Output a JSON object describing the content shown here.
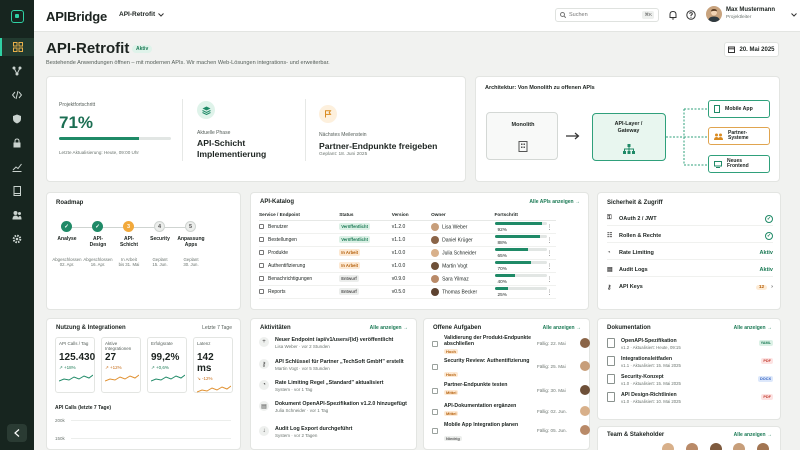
{
  "app": {
    "brand": "APIBridge",
    "project_selector": "API-Retrofit"
  },
  "search": {
    "placeholder": "Suchen",
    "shortcut": "⌘K"
  },
  "user": {
    "name": "Max Mustermann",
    "role": "Projektleiter"
  },
  "page": {
    "title": "API-Retrofit",
    "status_badge": "Aktiv",
    "subtitle": "Bestehende Anwendungen öffnen – mit modernen APIs. Wir machen Web-Lösungen integrations- und erweiterbar.",
    "date": "20. Mai 2025"
  },
  "overview": {
    "progress_label": "Projektfortschritt",
    "progress_value": "71%",
    "progress_fraction": 0.71,
    "last_update": "Letzte Aktualisierung: Heute, 09:00 Uhr",
    "phase_label": "Aktuelle Phase",
    "phase_value": "API-Schicht Implementierung",
    "milestone_label": "Nächstes Meilenstein",
    "milestone_value": "Partner-Endpunkte freigeben",
    "milestone_date": "Geplant: 18. Juni 2025"
  },
  "architecture": {
    "title": "Architektur: Von Monolith zu offenen APIs",
    "monolith": "Monolith",
    "layer_line1": "API-Layer /",
    "layer_line2": "Gateway",
    "targets": [
      "Mobile App",
      "Partner-\nSysteme",
      "Neues\nFrontend"
    ]
  },
  "roadmap": {
    "title": "Roadmap",
    "steps": [
      {
        "num": "✓",
        "label": "Analyse",
        "date": "Abgeschlossen\n02. Apr."
      },
      {
        "num": "✓",
        "label": "API-\nDesign",
        "date": "Abgeschlossen\n16. Apr."
      },
      {
        "num": "3",
        "label": "API-\nSchicht",
        "date": "In Arbeit\nbis 31. Mai"
      },
      {
        "num": "4",
        "label": "Security",
        "date": "Geplant\n15. Jun."
      },
      {
        "num": "5",
        "label": "Anpassung\nApps",
        "date": "Geplant\n30. Jun."
      }
    ]
  },
  "catalog": {
    "title": "API-Katalog",
    "link": "Alle APIs anzeigen →",
    "columns": [
      "Service / Endpoint",
      "Status",
      "Version",
      "Owner",
      "Fortschritt"
    ],
    "rows": [
      {
        "name": "Benutzer",
        "status": "Veröffentlicht",
        "kind": "green",
        "version": "v1.2.0",
        "owner": "Lisa Weber",
        "progress": "92%",
        "fraction": 0.92
      },
      {
        "name": "Bestellungen",
        "status": "Veröffentlicht",
        "kind": "green",
        "version": "v1.1.0",
        "owner": "Daniel Krüger",
        "progress": "88%",
        "fraction": 0.88
      },
      {
        "name": "Produkte",
        "status": "In Arbeit",
        "kind": "orange",
        "version": "v1.0.0",
        "owner": "Julia Schneider",
        "progress": "65%",
        "fraction": 0.65
      },
      {
        "name": "Authentifizierung",
        "status": "In Arbeit",
        "kind": "orange",
        "version": "v1.0.0",
        "owner": "Martin Vogt",
        "progress": "70%",
        "fraction": 0.7
      },
      {
        "name": "Benachrichtigungen",
        "status": "Entwurf",
        "kind": "gray",
        "version": "v0.9.0",
        "owner": "Sara Yilmaz",
        "progress": "40%",
        "fraction": 0.4
      },
      {
        "name": "Reports",
        "status": "Entwurf",
        "kind": "gray",
        "version": "v0.5.0",
        "owner": "Thomas Becker",
        "progress": "25%",
        "fraction": 0.25
      }
    ]
  },
  "security": {
    "title": "Sicherheit & Zugriff",
    "rows": [
      {
        "label": "OAuth 2 / JWT",
        "status": "✓"
      },
      {
        "label": "Rollen & Rechte",
        "status": "✓"
      },
      {
        "label": "Rate Limiting",
        "status": "Aktiv"
      },
      {
        "label": "Audit Logs",
        "status": "Aktiv"
      },
      {
        "label": "API Keys",
        "status": "12"
      }
    ]
  },
  "usage": {
    "title": "Nutzung & Integrationen",
    "range": "Letzte 7 Tage",
    "kpis": [
      {
        "label": "API Calls / Tag",
        "value": "125.430",
        "delta": "↗ +18%"
      },
      {
        "label": "Aktive Integrationen",
        "value": "27",
        "delta": "↗ +12%"
      },
      {
        "label": "Erfolgsrate",
        "value": "99,2%",
        "delta": "↗ +0,6%"
      },
      {
        "label": "Latenz",
        "value": "142 ms",
        "delta": "↘ -12%"
      }
    ],
    "chart_label": "API Calls (letzte 7 Tage)",
    "yticks": [
      "200k",
      "150k"
    ]
  },
  "activities": {
    "title": "Aktivitäten",
    "link": "Alle anzeigen →",
    "items": [
      {
        "title": "Neuer Endpoint /api/v1/users/{id} veröffentlicht",
        "sub": "Lisa Weber · vor 2 Stunden"
      },
      {
        "title": "API Schlüssel für Partner „TechSoft GmbH\" erstellt",
        "sub": "Martin Vogt · vor 5 Stunden"
      },
      {
        "title": "Rate Limiting Regel „Standard\" aktualisiert",
        "sub": "System · vor 1 Tag"
      },
      {
        "title": "Dokument OpenAPI-Spezifikation v1.2.0 hinzugefügt",
        "sub": "Julia Schneider · vor 1 Tag"
      },
      {
        "title": "Audit Log Export durchgeführt",
        "sub": "System · vor 2 Tagen"
      }
    ]
  },
  "tasks": {
    "title": "Offene Aufgaben",
    "link": "Alle anzeigen →",
    "items": [
      {
        "title": "Validierung der Produkt-Endpunkte abschließen",
        "prio": "Hoch",
        "kind": "orange",
        "due": "Fällig: 22. Mai"
      },
      {
        "title": "Security Review: Authentifizierung",
        "prio": "Hoch",
        "kind": "orange",
        "due": "Fällig: 25. Mai"
      },
      {
        "title": "Partner-Endpunkte testen",
        "prio": "Mittel",
        "kind": "orange",
        "due": "Fällig: 30. Mai"
      },
      {
        "title": "API-Dokumentation ergänzen",
        "prio": "Mittel",
        "kind": "orange",
        "due": "Fällig: 02. Jun."
      },
      {
        "title": "Mobile App Integration planen",
        "prio": "Niedrig",
        "kind": "gray",
        "due": "Fällig: 05. Jun."
      }
    ]
  },
  "docs": {
    "title": "Dokumentation",
    "link": "Alle anzeigen →",
    "items": [
      {
        "title": "OpenAPI-Spezifikation",
        "sub": "v1.2 · Aktualisiert: Heute, 09:15",
        "type": "YAML"
      },
      {
        "title": "Integrationsleitfaden",
        "sub": "v1.1 · Aktualisiert: 15. Mai 2025",
        "type": "PDF"
      },
      {
        "title": "Security-Konzept",
        "sub": "v1.0 · Aktualisiert: 15. Mai 2025",
        "type": "DOCX"
      },
      {
        "title": "API Design-Richtlinien",
        "sub": "v1.0 · Aktualisiert: 10. Mai 2025",
        "type": "PDF"
      }
    ]
  },
  "team": {
    "title": "Team & Stakeholder",
    "link": "Alle anzeigen →"
  }
}
